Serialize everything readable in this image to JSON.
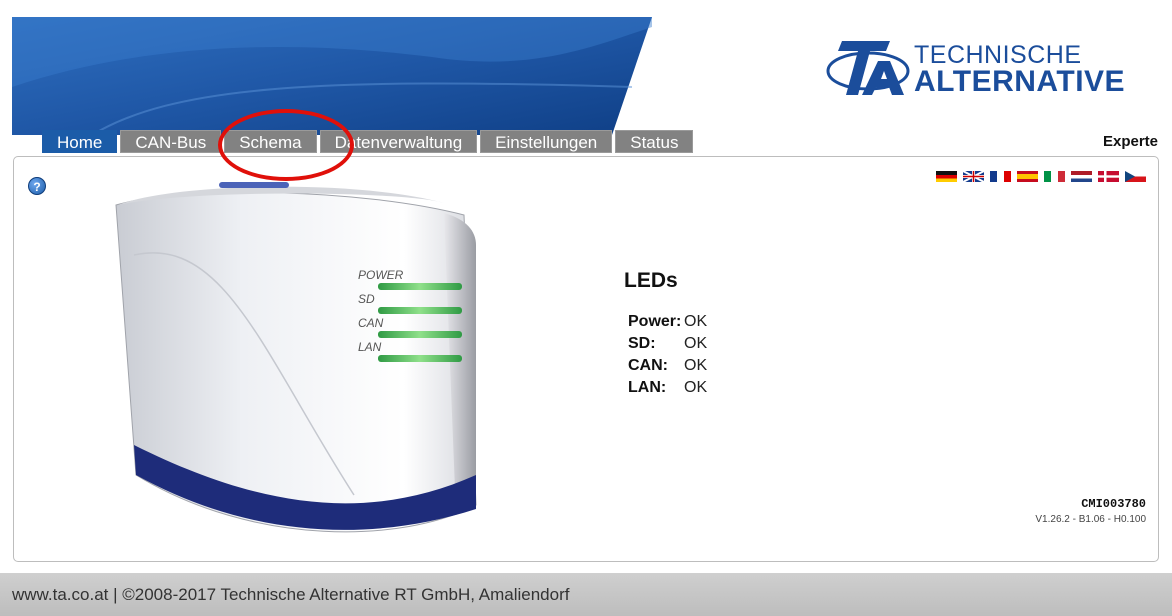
{
  "brand": {
    "logo_line1": "TECHNISCHE",
    "logo_line2": "ALTERNATIVE",
    "color_primary": "#1b5ca8"
  },
  "nav": {
    "tabs": [
      {
        "label": "Home",
        "active": true
      },
      {
        "label": "CAN-Bus",
        "active": false
      },
      {
        "label": "Schema",
        "active": false
      },
      {
        "label": "Datenverwaltung",
        "active": false
      },
      {
        "label": "Einstellungen",
        "active": false
      },
      {
        "label": "Status",
        "active": false
      }
    ],
    "mode_label": "Experte"
  },
  "content": {
    "help_icon": "help-icon",
    "languages": [
      "de",
      "en",
      "fr",
      "es",
      "it",
      "nl",
      "dk",
      "cz"
    ],
    "device_labels": {
      "power": "POWER",
      "sd": "SD",
      "can": "CAN",
      "lan": "LAN"
    },
    "leds": {
      "title": "LEDs",
      "rows": [
        {
          "label": "Power:",
          "value": "OK"
        },
        {
          "label": "SD:",
          "value": "OK"
        },
        {
          "label": "CAN:",
          "value": "OK"
        },
        {
          "label": "LAN:",
          "value": "OK"
        }
      ]
    },
    "device_id": "CMI003780",
    "version": "V1.26.2 - B1.06 - H0.100"
  },
  "annotation": {
    "highlighted_tab": "Schema",
    "color": "#e0100a"
  },
  "footer": {
    "text": "www.ta.co.at | ©2008-2017 Technische Alternative RT GmbH, Amaliendorf"
  }
}
